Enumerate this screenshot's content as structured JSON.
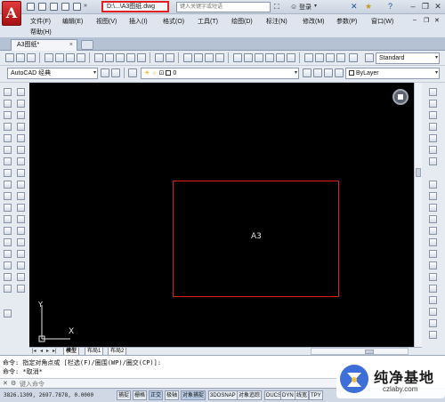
{
  "title_bar": {
    "app_logo": "A",
    "file_title": "D:\\...\\A3图纸.dwg",
    "search_placeholder": "键入关键字或短语",
    "login_label": "登录",
    "minimize_glyph": "–",
    "restore_glyph": "❐",
    "close_glyph": "✕",
    "highlight_color": "#e02020"
  },
  "menu": {
    "row1": [
      "文件(F)",
      "编辑(E)",
      "视图(V)",
      "插入(I)",
      "格式(O)",
      "工具(T)",
      "绘图(D)",
      "标注(N)",
      "修改(M)",
      "参数(P)",
      "窗口(W)"
    ],
    "row2": [
      "帮助(H)"
    ],
    "doc_min_glyph": "–",
    "doc_restore_glyph": "❐",
    "doc_close_glyph": "✕"
  },
  "tabs": {
    "active_doc": "A3图纸*",
    "close_glyph": "×"
  },
  "toolbars": {
    "text_style": "Standard",
    "workspace": "AutoCAD 经典",
    "layer": "0",
    "color": "ByLayer"
  },
  "drawing": {
    "background": "#000000",
    "sheet_label": "A3",
    "sheet_border_color": "#d82020",
    "ucs_y_label": "Y",
    "ucs_x_label": "X"
  },
  "layout_tabs": [
    "模型",
    "布局1",
    "布局2"
  ],
  "command": {
    "line1": "命令: 指定对角点或 [栏选(F)/圈围(WP)/圈交(CP)]:",
    "line2": "命令: *取消*",
    "input_placeholder": "键入命令"
  },
  "status": {
    "coordinates": "3826.1309, 2697.7878, 0.0000",
    "toggles": [
      {
        "label": "捕捉",
        "on": false
      },
      {
        "label": "栅格",
        "on": false
      },
      {
        "label": "正交",
        "on": true
      },
      {
        "label": "极轴",
        "on": false
      },
      {
        "label": "对象捕捉",
        "on": true
      },
      {
        "label": "3DOSNAP",
        "on": false
      },
      {
        "label": "对象追踪",
        "on": false
      },
      {
        "label": "DUCS",
        "on": false
      },
      {
        "label": "DYN",
        "on": false
      },
      {
        "label": "线宽",
        "on": false
      },
      {
        "label": "TPY",
        "on": false
      }
    ]
  },
  "watermark": {
    "title": "纯净基地",
    "url": "czlaby.com"
  }
}
